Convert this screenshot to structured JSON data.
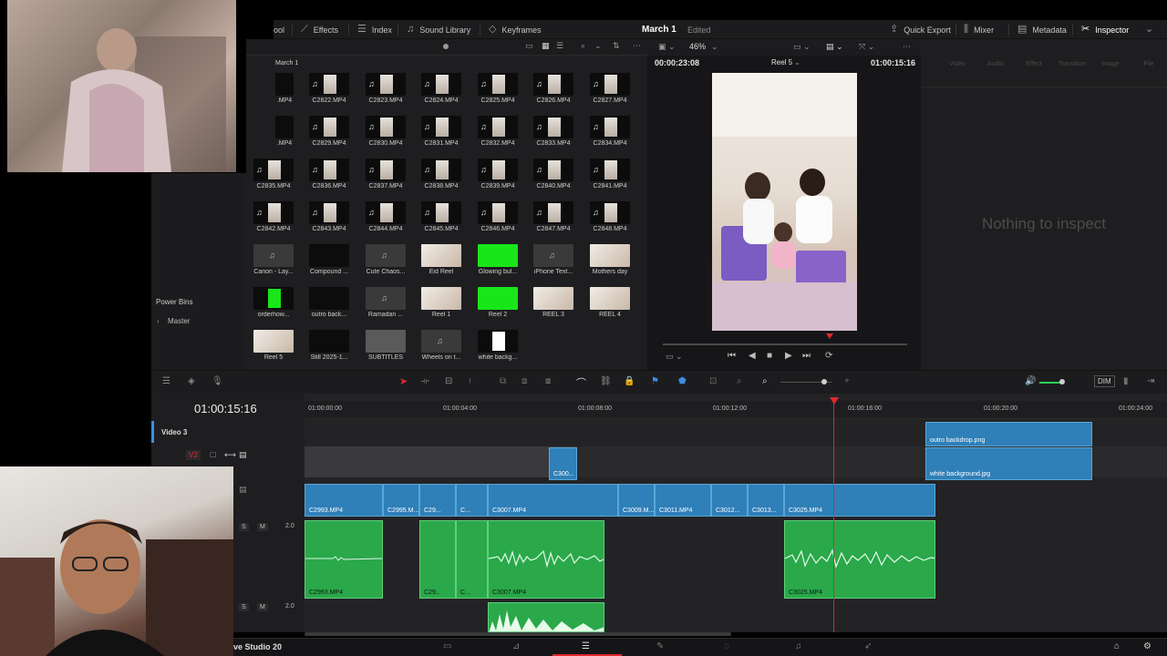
{
  "toolbar": {
    "items": [
      {
        "label": "ool",
        "icon": "media-pool-icon"
      },
      {
        "label": "Effects",
        "icon": "effects-icon"
      },
      {
        "label": "Index",
        "icon": "index-icon"
      },
      {
        "label": "Sound Library",
        "icon": "sound-library-icon"
      },
      {
        "label": "Keyframes",
        "icon": "keyframes-icon"
      }
    ],
    "project_title": "March 1",
    "project_status": "Edited",
    "right_items": [
      {
        "label": "Quick Export",
        "icon": "export-icon"
      },
      {
        "label": "Mixer",
        "icon": "mixer-icon"
      },
      {
        "label": "Metadata",
        "icon": "metadata-icon"
      },
      {
        "label": "Inspector",
        "icon": "inspector-icon"
      }
    ]
  },
  "media_pool": {
    "zoom": "46%",
    "path": "March 1",
    "clips": [
      "C2822.MP4",
      "C2823.MP4",
      "C2824.MP4",
      "C2825.MP4",
      "C2826.MP4",
      "C2827.MP4",
      "C2829.MP4",
      "C2830.MP4",
      "C2831.MP4",
      "C2832.MP4",
      "C2833.MP4",
      "C2834.MP4",
      "C2835.MP4",
      "C2836.MP4",
      "C2837.MP4",
      "C2838.MP4",
      "C2839.MP4",
      "C2840.MP4",
      "C2841.MP4",
      "C2842.MP4",
      "C2843.MP4",
      "C2844.MP4",
      "C2845.MP4",
      "C2846.MP4",
      "C2847.MP4",
      "C2848.MP4",
      "Canon - Lay...",
      "Compound ...",
      "Cute Chaos...",
      "Eid Reel",
      "Glowing bul...",
      "iPhone Text...",
      "Mothers day",
      "orderhow...",
      "outro back...",
      "Ramadan ...",
      "Reel 1",
      "Reel 2",
      "REEL 3",
      "REEL 4",
      "Reel 5",
      "Still 2025-1...",
      "SUBTITLES",
      "Wheels on t...",
      "white backg..."
    ],
    "partial_labels": [
      ".MP4",
      ".MP4"
    ]
  },
  "bins": {
    "power_bins": "Power Bins",
    "master": "Master"
  },
  "viewer": {
    "timecode_left": "00:00:23:08",
    "timeline_name": "Reel 5",
    "timecode_right": "01:00:15:16"
  },
  "inspector": {
    "tabs": [
      "Video",
      "Audio",
      "Effect",
      "Transition",
      "Image",
      "File"
    ],
    "empty_message": "Nothing to inspect"
  },
  "timeline": {
    "current_timecode": "01:00:15:16",
    "ruler": [
      "01:00:00:00",
      "01:00:04:00",
      "01:00:08:00",
      "01:00:12:00",
      "01:00:16:00",
      "01:00:20:00",
      "01:00:24:00"
    ],
    "tracks": {
      "video3": "Video 3",
      "v2": "V2",
      "audio_level": "2.0",
      "solo": "S",
      "mute": "M"
    },
    "dim_label": "DIM",
    "v3_clips": [
      "outro backdrop.png"
    ],
    "v2_clips": [
      "C300...",
      "white background.jpg"
    ],
    "v1_clips": [
      "C2993.MP4",
      "C2995.M...",
      "C29...",
      "C...",
      "C3007.MP4",
      "C3009.M...",
      "C3011.MP4",
      "C3012...",
      "C3013...",
      "C3025.MP4"
    ],
    "a1_clips": [
      "C2993.MP4",
      "C29...",
      "C...",
      "C3007.MP4",
      "C3025.MP4"
    ]
  },
  "bottom": {
    "app_name": "ve Studio 20"
  },
  "colors": {
    "video_clip": "#2f7fb8",
    "audio_clip": "#2aa84a",
    "playhead": "#e0282f",
    "accent_active": "#ffffff"
  }
}
